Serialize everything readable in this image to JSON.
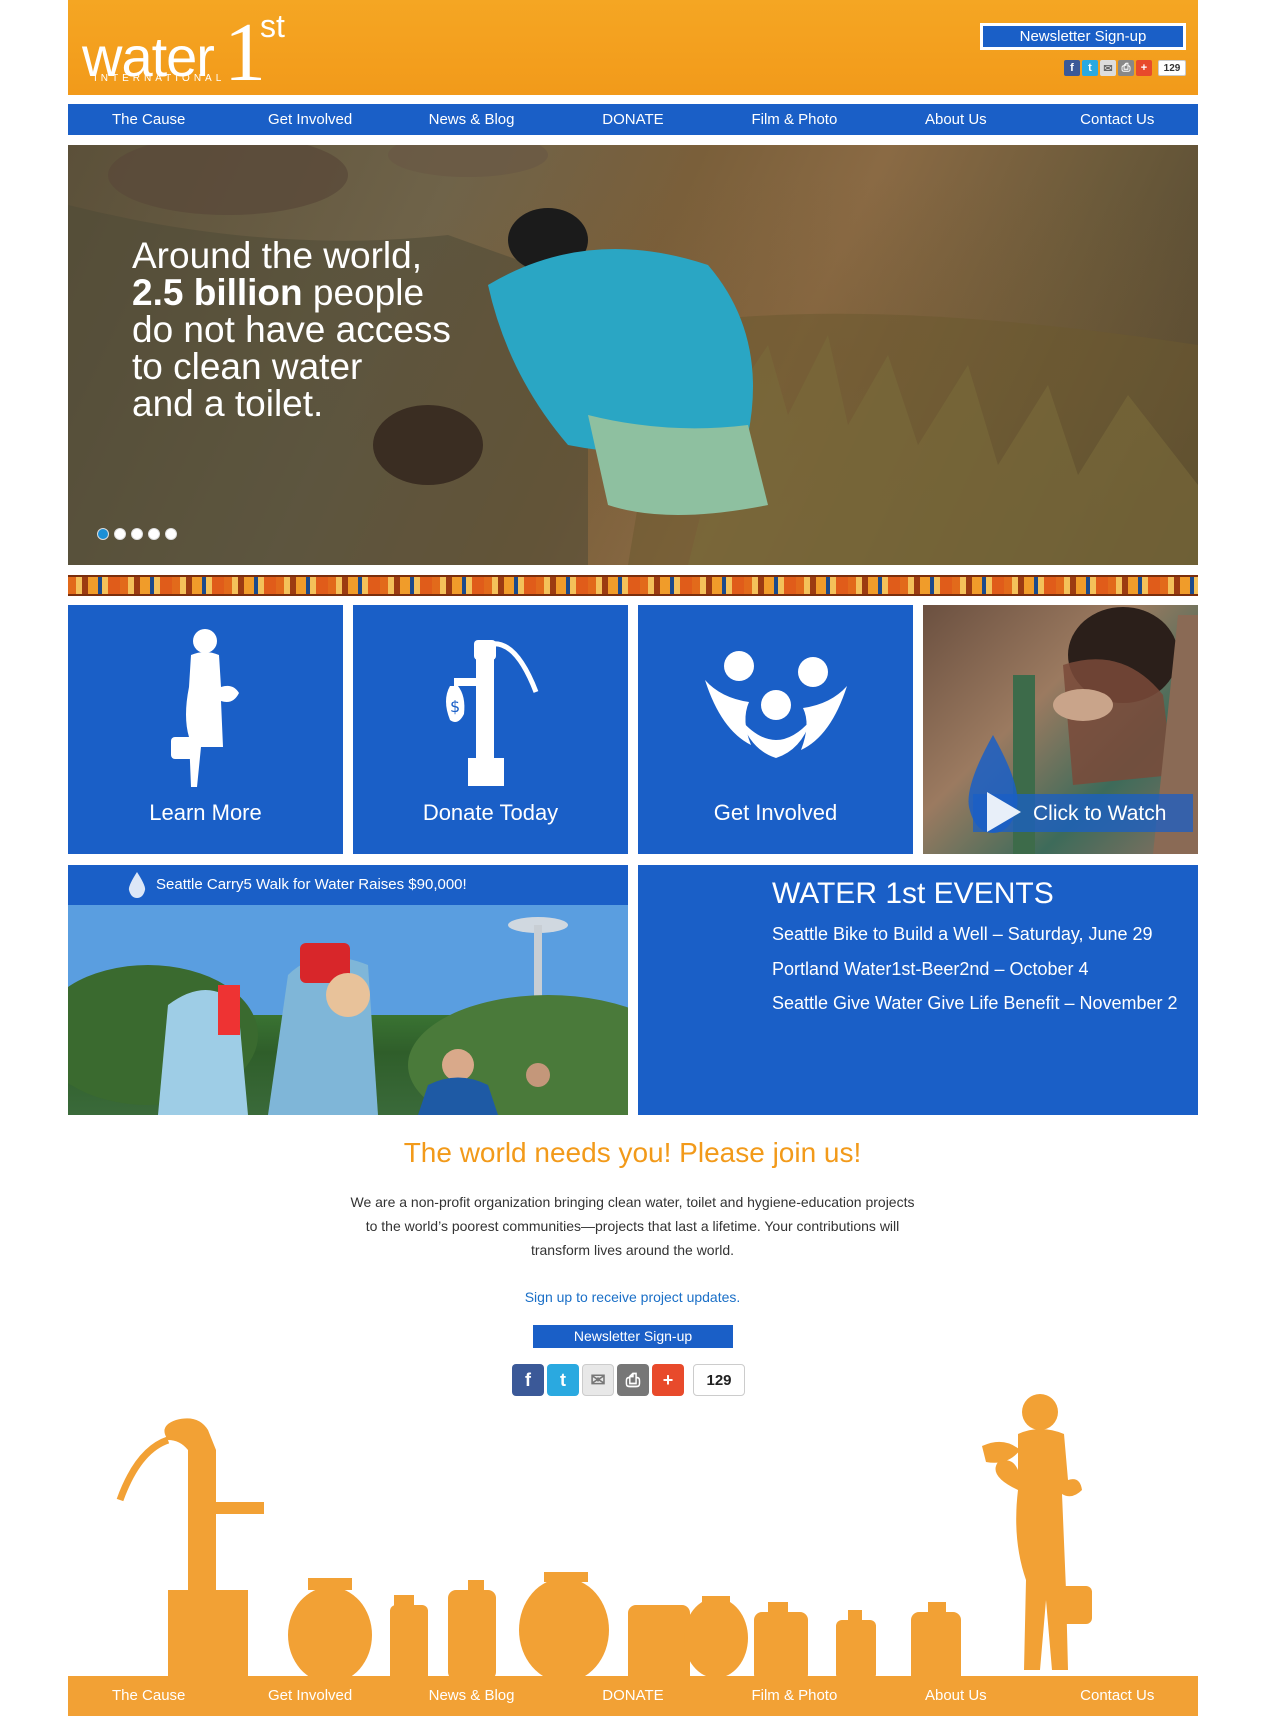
{
  "brand": {
    "logo_word": "water",
    "logo_one": "1",
    "logo_st": "st",
    "logo_sub": "INTERNATIONAL"
  },
  "header": {
    "newsletter_label": "Newsletter Sign-up",
    "share_count": "129"
  },
  "nav": {
    "items": [
      "The Cause",
      "Get Involved",
      "News & Blog",
      "DONATE",
      "Film & Photo",
      "About Us",
      "Contact Us"
    ]
  },
  "hero": {
    "line1": "Around the world,",
    "line2_strong": "2.5 billion",
    "line2_rest": " people",
    "line3": "do not have access",
    "line4": "to clean water",
    "line5": "and a toilet.",
    "active_slide": 1,
    "slide_count": 5
  },
  "tiles": {
    "learn": "Learn More",
    "donate": "Donate Today",
    "involved": "Get Involved",
    "watch": "Click to Watch"
  },
  "news": {
    "title": "Seattle Carry5 Walk for Water Raises $90,000!"
  },
  "events": {
    "heading": "WATER 1st EVENTS",
    "items": [
      "Seattle Bike to Build a Well – Saturday, June 29",
      "Portland Water1st-Beer2nd – October 4",
      "Seattle Give Water Give Life Benefit – November 2"
    ]
  },
  "join": {
    "heading": "The world needs you! Please join us!",
    "p1": "We are a non-profit organization bringing clean water, toilet and hygiene-education projects",
    "p2": "to the world’s poorest communities—projects that last a lifetime. Your contributions will",
    "p3": "transform lives around the world.",
    "link": "Sign up to receive project updates.",
    "button": "Newsletter Sign-up",
    "share_count": "129"
  },
  "colors": {
    "orange": "#f29a1a",
    "blue": "#1a5fc7",
    "footer_orange": "#f2a135"
  },
  "icons": {
    "facebook": "facebook-icon",
    "twitter": "twitter-icon",
    "email": "email-icon",
    "print": "print-icon",
    "plus": "plus-icon"
  }
}
